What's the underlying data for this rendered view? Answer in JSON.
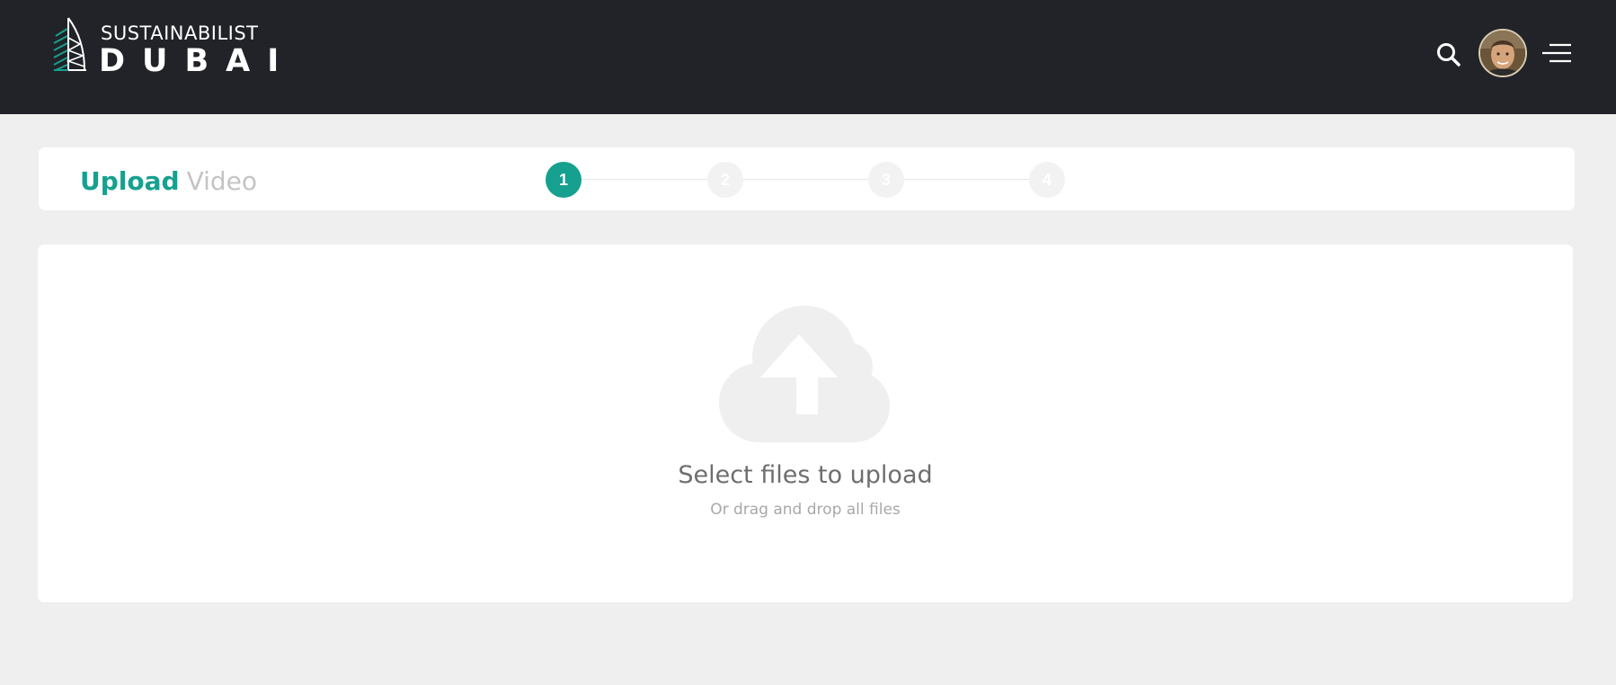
{
  "header": {
    "logo_top": "SUSTAINABILIST",
    "logo_bottom": "DUBAI",
    "search_icon": "search-icon",
    "avatar_icon": "avatar",
    "menu_icon": "menu-icon"
  },
  "steps": {
    "title_strong": "Upload",
    "title_light": "Video",
    "items": [
      {
        "number": "1",
        "active": true
      },
      {
        "number": "2",
        "active": false
      },
      {
        "number": "3",
        "active": false
      },
      {
        "number": "4",
        "active": false
      }
    ]
  },
  "upload": {
    "icon": "cloud-upload-icon",
    "title": "Select files to upload",
    "subtitle": "Or drag and drop all files"
  },
  "colors": {
    "accent": "#16a08f",
    "header_bg": "#212328",
    "page_bg": "#efefef"
  }
}
